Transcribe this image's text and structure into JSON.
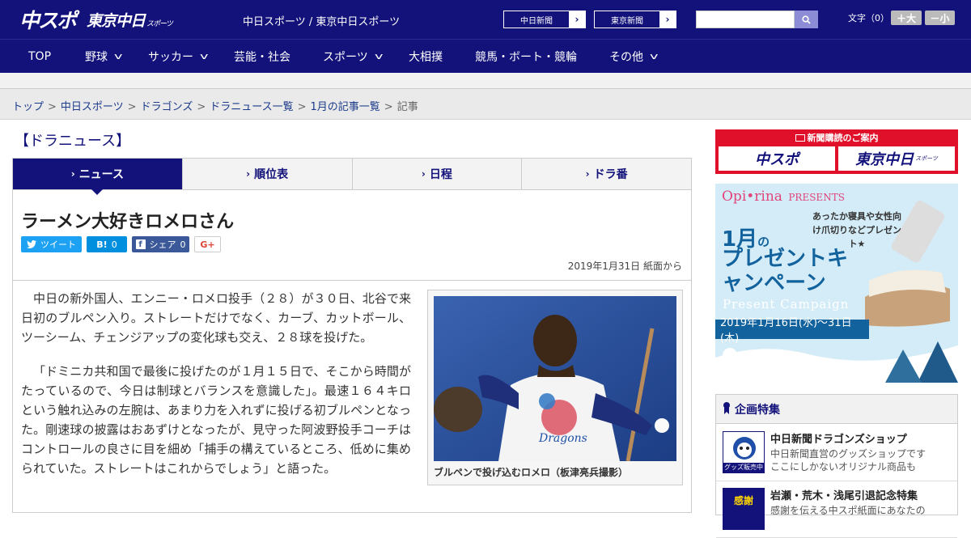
{
  "header": {
    "logo_main": "中スポ",
    "logo_tokyo": "東京中日",
    "logo_tokyo_small": "スポーツ",
    "site_title": "中日スポーツ / 東京中日スポーツ",
    "links": [
      "中日新聞",
      "東京新聞"
    ],
    "link_arrow": "›",
    "font_size_label": "文字（0）",
    "font_bigger": "＋大",
    "font_smaller": "－小"
  },
  "nav": {
    "items": [
      "TOP",
      "野球",
      "サッカー",
      "芸能・社会",
      "スポーツ",
      "大相撲",
      "競馬・ボート・競輪",
      "その他"
    ],
    "chevron": "v"
  },
  "breadcrumb": {
    "items": [
      "トップ",
      "中日スポーツ",
      "ドラゴンズ",
      "ドラニュース一覧",
      "1月の記事一覧"
    ],
    "current": "記事",
    "separator": ">"
  },
  "section_title": "【ドラニュース】",
  "tabs": {
    "items": [
      "ニュース",
      "順位表",
      "日程",
      "ドラ番"
    ],
    "arrow": "›",
    "active": "ニュース"
  },
  "article": {
    "headline": "ラーメン大好きロメロさん",
    "share": {
      "tweet": "ツイート",
      "hatena": "B!",
      "hatena_count": "0",
      "facebook": "シェア",
      "facebook_count": "0",
      "gplus": "G+"
    },
    "date": "2019年1月31日 紙面から",
    "paragraphs": [
      "中日の新外国人、エンニー・ロメロ投手（２８）が３０日、北谷で来日初のブルペン入り。ストレートだけでなく、カーブ、カットボール、ツーシーム、チェンジアップの変化球も交え、２８球を投げた。",
      "「ドミニカ共和国で最後に投げたのが１月１５日で、そこから時間がたっているので、今日は制球とバランスを意識した」。最速１６４キロという触れ込みの左腕は、あまり力を入れずに投げる初ブルペンとなった。剛速球の披露はおあずけとなったが、見守った阿波野投手コーチはコントロールの良さに目を細め「捕手の構えているところ、低めに集められていた。ストレートはこれからでしょう」と語った。"
    ],
    "photo_caption": "ブルペンで投げ込むロメロ（板津亮兵撮影）"
  },
  "sidebar": {
    "subscription": {
      "title": "新聞購読のご案内",
      "btn_chuspo": "中スポ",
      "btn_tokyo": "東京中日",
      "btn_tokyo_small": "スポーツ"
    },
    "promo": {
      "brand": "Opi•rina",
      "brand_suffix": "PRESENTS",
      "gift": "あったか寝具や女性向け爪切りなどプレゼント★",
      "month": "1月",
      "month_suffix": "の",
      "main": "プレゼントキャンペーン",
      "english": "Present Campaign",
      "dates": "2019年1月16日(水)～31日(木)"
    },
    "feature": {
      "heading": "企画特集",
      "items": [
        {
          "title": "中日新聞ドラゴンズショップ",
          "desc1": "中日新聞直営のグッズショップです",
          "desc2": "ここにしかないオリジナル商品も",
          "thumb_label": "グッズ販売中"
        },
        {
          "title": "岩瀬・荒木・浅尾引退記念特集",
          "desc1": "感謝を伝える中スポ紙面にあなたの",
          "desc2": "",
          "thumb_label": "感謝"
        }
      ]
    }
  },
  "colors": {
    "brand_navy": "#12127a",
    "accent_red": "#e0102a",
    "twitter": "#1da1f2",
    "hatena": "#008fde",
    "facebook": "#3b5998"
  }
}
